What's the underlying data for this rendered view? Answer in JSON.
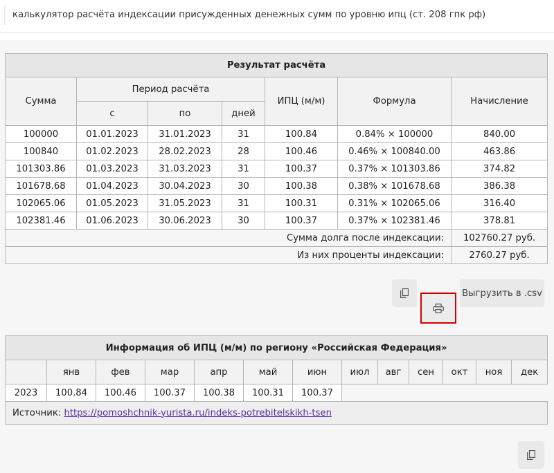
{
  "header": {
    "title": "калькулятор расчёта индексации присужденных денежных сумм по уровню ипц (ст. 208 гпк рф)"
  },
  "result": {
    "caption": "Результат расчёта",
    "headers": {
      "sum": "Сумма",
      "period": "Период расчёта",
      "from": "с",
      "to": "по",
      "days": "дней",
      "ipc": "ИПЦ (м/м)",
      "formula": "Формула",
      "accrual": "Начисление"
    },
    "rows": [
      {
        "sum": "100000",
        "from": "01.01.2023",
        "to": "31.01.2023",
        "days": "31",
        "ipc": "100.84",
        "formula": "0.84% × 100000",
        "accrual": "840.00"
      },
      {
        "sum": "100840",
        "from": "01.02.2023",
        "to": "28.02.2023",
        "days": "28",
        "ipc": "100.46",
        "formula": "0.46% × 100840.00",
        "accrual": "463.86"
      },
      {
        "sum": "101303.86",
        "from": "01.03.2023",
        "to": "31.03.2023",
        "days": "31",
        "ipc": "100.37",
        "formula": "0.37% × 101303.86",
        "accrual": "374.82"
      },
      {
        "sum": "101678.68",
        "from": "01.04.2023",
        "to": "30.04.2023",
        "days": "30",
        "ipc": "100.38",
        "formula": "0.38% × 101678.68",
        "accrual": "386.38"
      },
      {
        "sum": "102065.06",
        "from": "01.05.2023",
        "to": "31.05.2023",
        "days": "31",
        "ipc": "100.31",
        "formula": "0.31% × 102065.06",
        "accrual": "316.40"
      },
      {
        "sum": "102381.46",
        "from": "01.06.2023",
        "to": "30.06.2023",
        "days": "30",
        "ipc": "100.37",
        "formula": "0.37% × 102381.46",
        "accrual": "378.81"
      }
    ],
    "totals": [
      {
        "label": "Сумма долга после индексации:",
        "value": "102760.27 руб."
      },
      {
        "label": "Из них проценты индексации:",
        "value": "2760.27 руб."
      }
    ]
  },
  "actions": {
    "copy_icon": "copy-icon",
    "print_icon": "printer-icon",
    "csv_label": "Выгрузить в .csv",
    "highlight_color": "#d00000"
  },
  "ipc_table": {
    "caption": "Информация об ИПЦ (м/м) по региону «Российская Федерация»",
    "months": [
      "янв",
      "фев",
      "мар",
      "апр",
      "май",
      "июн",
      "июл",
      "авг",
      "сен",
      "окт",
      "ноя",
      "дек"
    ],
    "year": "2023",
    "values": [
      "100.84",
      "100.46",
      "100.37",
      "100.38",
      "100.31",
      "100.37"
    ],
    "source_label": "Источник:",
    "source_link": "https://pomoshchnik-yurista.ru/indeks-potrebitelskikh-tsen",
    "link_color": "#5a2ea6"
  }
}
